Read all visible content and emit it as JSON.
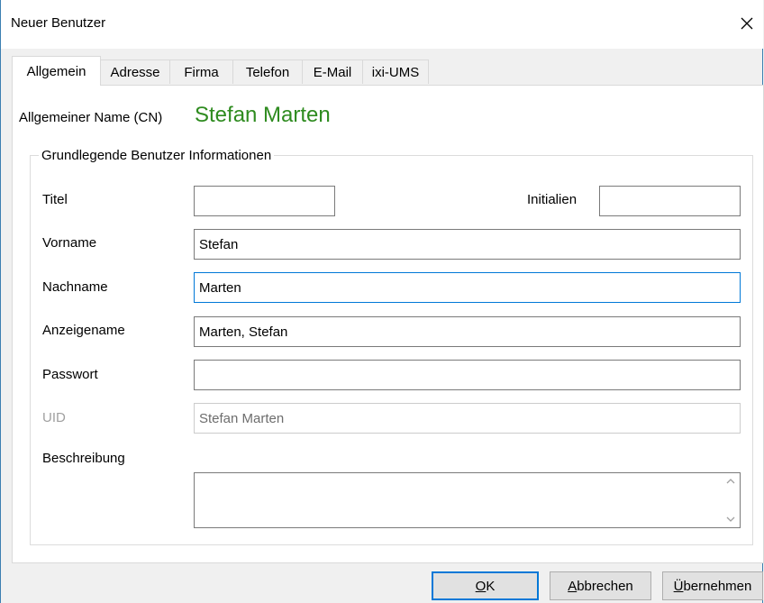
{
  "window": {
    "title": "Neuer Benutzer"
  },
  "tabs": [
    {
      "label": "Allgemein",
      "active": true
    },
    {
      "label": "Adresse",
      "active": false
    },
    {
      "label": "Firma",
      "active": false
    },
    {
      "label": "Telefon",
      "active": false
    },
    {
      "label": "E-Mail",
      "active": false
    },
    {
      "label": "ixi-UMS",
      "active": false
    }
  ],
  "cn": {
    "label": "Allgemeiner Name (CN)",
    "value": "Stefan Marten",
    "color": "#2e8b1f"
  },
  "group": {
    "legend": "Grundlegende Benutzer Informationen"
  },
  "fields": {
    "titel": {
      "label": "Titel",
      "value": ""
    },
    "initialien": {
      "label": "Initialien",
      "value": ""
    },
    "vorname": {
      "label": "Vorname",
      "value": "Stefan"
    },
    "nachname": {
      "label": "Nachname",
      "value": "Marten"
    },
    "anzeigename": {
      "label": "Anzeigename",
      "value": "Marten, Stefan"
    },
    "passwort": {
      "label": "Passwort",
      "value": ""
    },
    "uid": {
      "label": "UID",
      "value": "Stefan Marten"
    },
    "beschreibung": {
      "label": "Beschreibung",
      "value": ""
    }
  },
  "buttons": {
    "ok": {
      "mnemonic": "O",
      "rest": "K"
    },
    "abbrechen": {
      "mnemonic": "A",
      "rest": "bbrechen"
    },
    "uebernehmen": {
      "mnemonic": "Ü",
      "rest": "bernehmen"
    }
  },
  "icons": {
    "close": "close-icon",
    "scroll_up": "chevron-up-icon",
    "scroll_down": "chevron-down-icon"
  },
  "colors": {
    "accent": "#0078d7",
    "window_border": "#3c7fb1"
  }
}
